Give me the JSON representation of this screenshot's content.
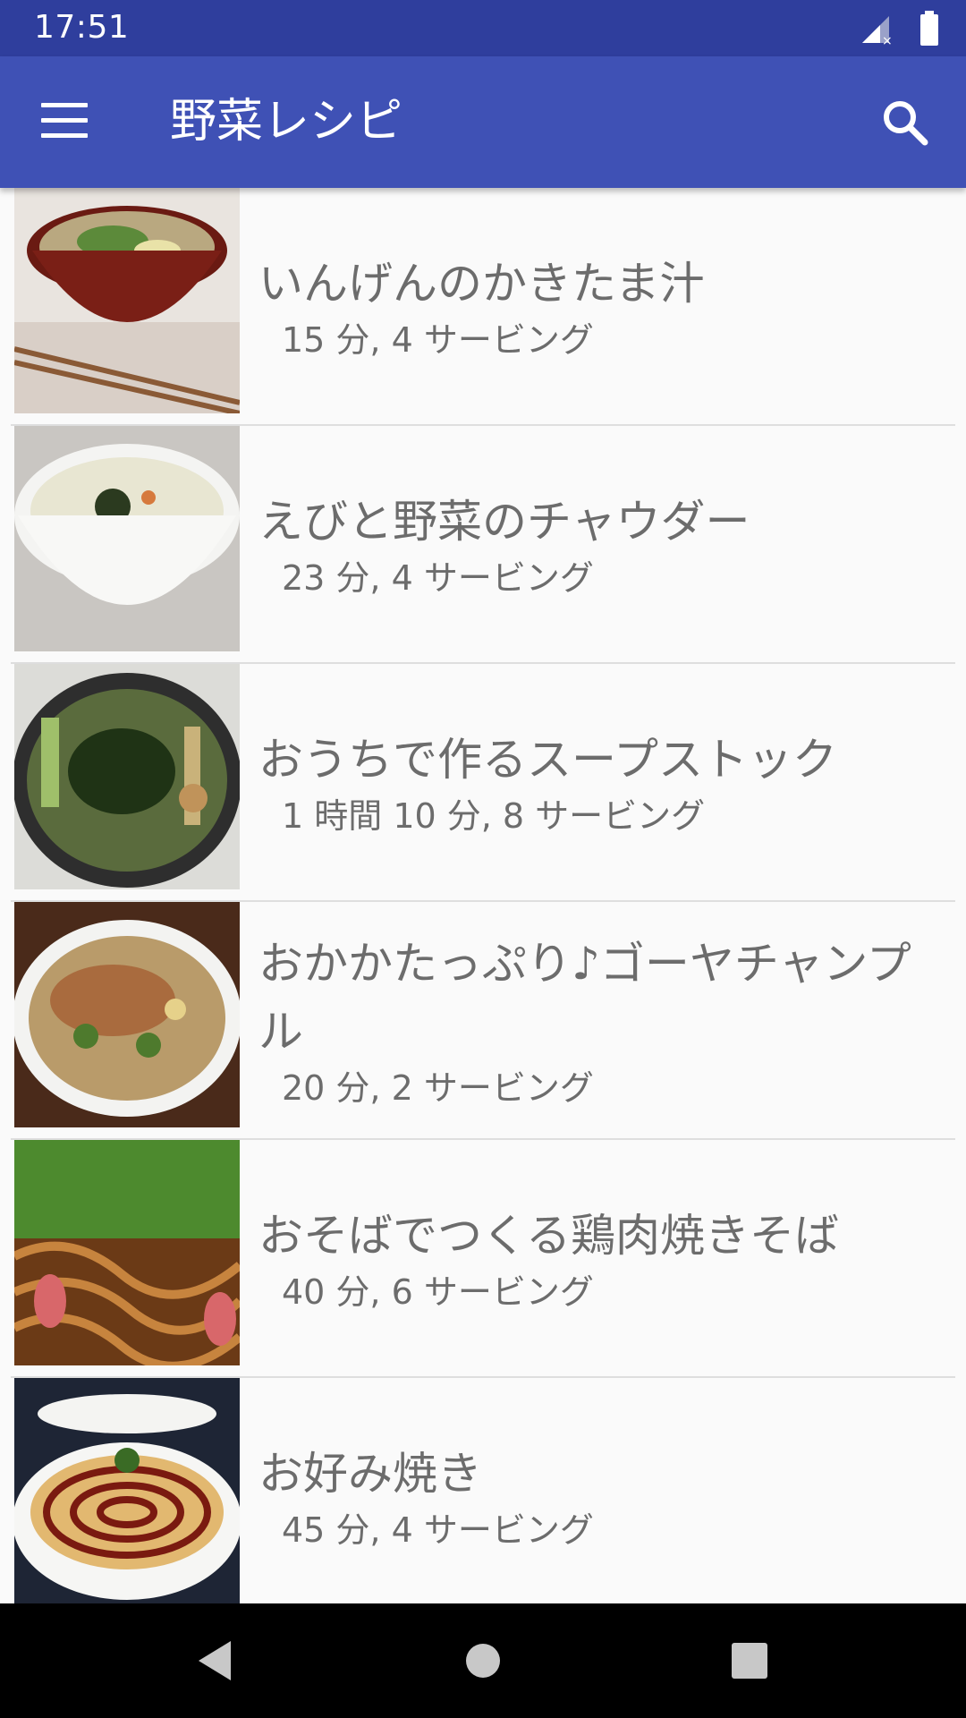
{
  "status_bar": {
    "time": "17:51"
  },
  "app_bar": {
    "title": "野菜レシピ"
  },
  "recipes": [
    {
      "title": "いんげんのかきたま汁",
      "meta": "15 分, 4 サービング"
    },
    {
      "title": "えびと野菜のチャウダー",
      "meta": "23 分, 4 サービング"
    },
    {
      "title": "おうちで作るスープストック",
      "meta": "1 時間 10 分, 8 サービング"
    },
    {
      "title": "おかかたっぷり♪ゴーヤチャンプル",
      "meta": "20 分, 2 サービング"
    },
    {
      "title": "おそばでつくる鶏肉焼きそば",
      "meta": "40 分, 6 サービング"
    },
    {
      "title": "お好み焼き",
      "meta": "45 分, 4 サービング"
    }
  ],
  "colors": {
    "status_bar": "#2f3e9d",
    "app_bar": "#3f51b5",
    "text": "#6c6c6c"
  }
}
